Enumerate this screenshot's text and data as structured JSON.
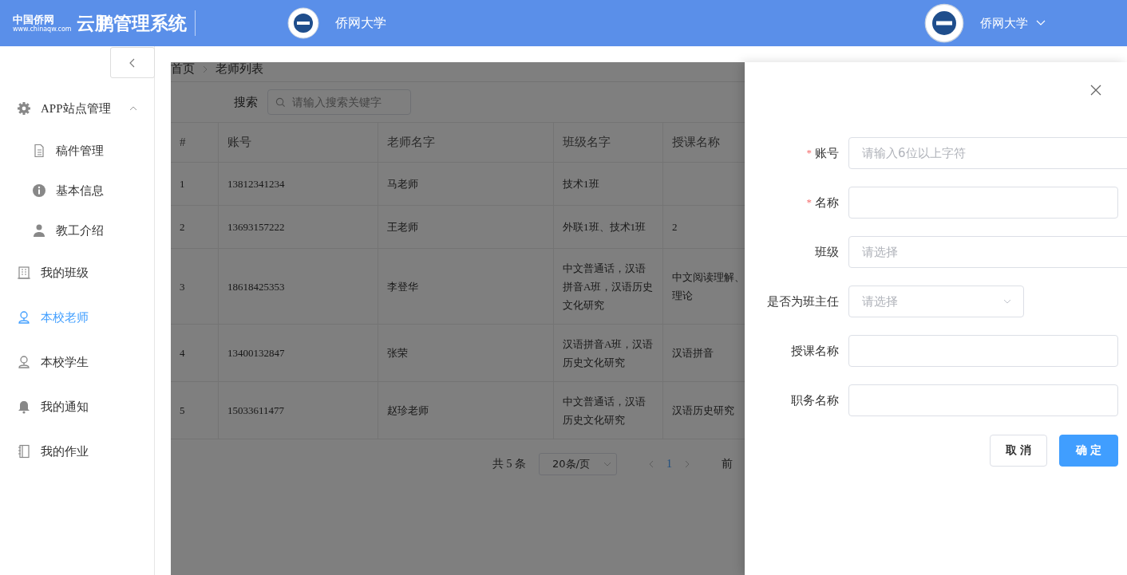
{
  "header": {
    "logo_mark": "中国侨网",
    "logo_url": "www.chinaqw.com",
    "system_name": "云鹏管理系统",
    "school_name": "侨网大学",
    "user_name": "侨网大学"
  },
  "sidebar": {
    "items": [
      {
        "label": "APP站点管理",
        "expanded": true,
        "selected": false,
        "children": [
          {
            "label": "稿件管理",
            "selected": false
          },
          {
            "label": "基本信息",
            "selected": false
          },
          {
            "label": "教工介绍",
            "selected": false
          }
        ]
      },
      {
        "label": "我的班级",
        "selected": false
      },
      {
        "label": "本校老师",
        "selected": true
      },
      {
        "label": "本校学生",
        "selected": false
      },
      {
        "label": "我的通知",
        "selected": false
      },
      {
        "label": "我的作业",
        "selected": false
      }
    ]
  },
  "breadcrumb": [
    "首页",
    "老师列表"
  ],
  "search": {
    "label": "搜索",
    "placeholder": "请输入搜索关键字"
  },
  "table": {
    "columns": [
      "#",
      "账号",
      "老师名字",
      "班级名字",
      "授课名称"
    ],
    "rows": [
      [
        "1",
        "13812341234",
        "马老师",
        "技术1班",
        ""
      ],
      [
        "2",
        "13693157222",
        "王老师",
        "外联1班、技术1班",
        "2"
      ],
      [
        "3",
        "18618425353",
        "李登华",
        "中文普通话，汉语拼音A班，汉语历史文化研究",
        "中文阅读理解、理论"
      ],
      [
        "4",
        "13400132847",
        "张荣",
        "汉语拼音A班，汉语历史文化研究",
        "汉语拼音"
      ],
      [
        "5",
        "15033611477",
        "赵珍老师",
        "中文普通话，汉语历史文化研究",
        "汉语历史研究"
      ]
    ]
  },
  "pagination": {
    "total": "共 5 条",
    "page_size": "20条/页",
    "pages": [
      {
        "label": "1",
        "selected": true
      }
    ],
    "jump_label": "前"
  },
  "drawer": {
    "fields": [
      {
        "label": "账号",
        "required_mark": "*",
        "kind": "input",
        "placeholder": "请输入6位以上字符"
      },
      {
        "label": "名称",
        "required_mark": "*",
        "kind": "input"
      },
      {
        "label": "班级",
        "kind": "select",
        "placeholder": "请选择"
      },
      {
        "label": "是否为班主任",
        "kind": "select",
        "placeholder": "请选择"
      },
      {
        "label": "授课名称",
        "kind": "input"
      },
      {
        "label": "职务名称",
        "kind": "input"
      }
    ],
    "buttons": [
      {
        "label": "取 消",
        "kind": "default"
      },
      {
        "label": "确 定",
        "kind": "primary"
      }
    ]
  }
}
